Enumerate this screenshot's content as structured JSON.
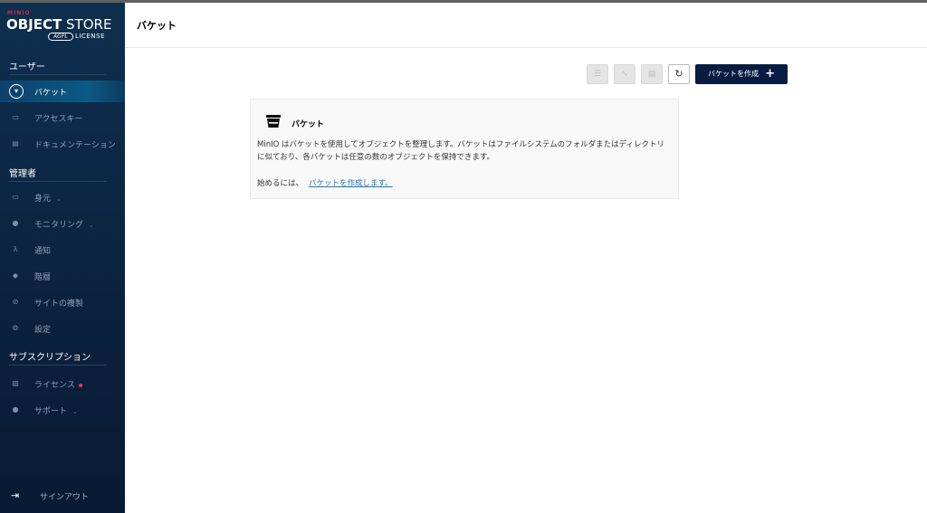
{
  "logo": {
    "brand": "MINIO",
    "title_bold": "OBJECT",
    "title_rest": " STORE",
    "agpl": "AGPL",
    "license": "LICENSE"
  },
  "sidebar": {
    "sections": [
      {
        "label": "ユーザー"
      },
      {
        "label": "管理者"
      },
      {
        "label": "サブスクリプション"
      }
    ],
    "items": [
      {
        "label": "バケット",
        "icon": "bucket-icon"
      },
      {
        "label": "アクセスキー",
        "icon": "key-icon"
      },
      {
        "label": "ドキュメンテーション",
        "icon": "docs-icon"
      },
      {
        "label": "身元",
        "icon": "identity-icon",
        "chevron": "⌄"
      },
      {
        "label": "モニタリング",
        "icon": "monitoring-icon",
        "chevron": "⌄"
      },
      {
        "label": "通知",
        "icon": "notification-icon"
      },
      {
        "label": "階層",
        "icon": "tiers-icon"
      },
      {
        "label": "サイトの複製",
        "icon": "replication-icon"
      },
      {
        "label": "設定",
        "icon": "settings-icon"
      },
      {
        "label": "ライセンス",
        "icon": "license-icon"
      },
      {
        "label": "サポート",
        "icon": "support-icon",
        "chevron": "⌄"
      }
    ],
    "signout": "サインアウト"
  },
  "header": {
    "title": "バケット"
  },
  "toolbar": {
    "create_label": "バケットを作成"
  },
  "card": {
    "title": "バケット",
    "description": "MinIO はバケットを使用してオブジェクトを整理します。バケットはファイルシステムのフォルダまたはディレクトリに似ており、各バケットは任意の数のオブジェクトを保持できます。",
    "start_prefix": "始めるには、",
    "start_link": "バケットを作成します。"
  },
  "colors": {
    "sidebar_bg": "#0b2440",
    "active_item": "#0c5a86",
    "primary_button": "#081c42",
    "link": "#1f7bc1",
    "license_dot": "#ff3547"
  }
}
